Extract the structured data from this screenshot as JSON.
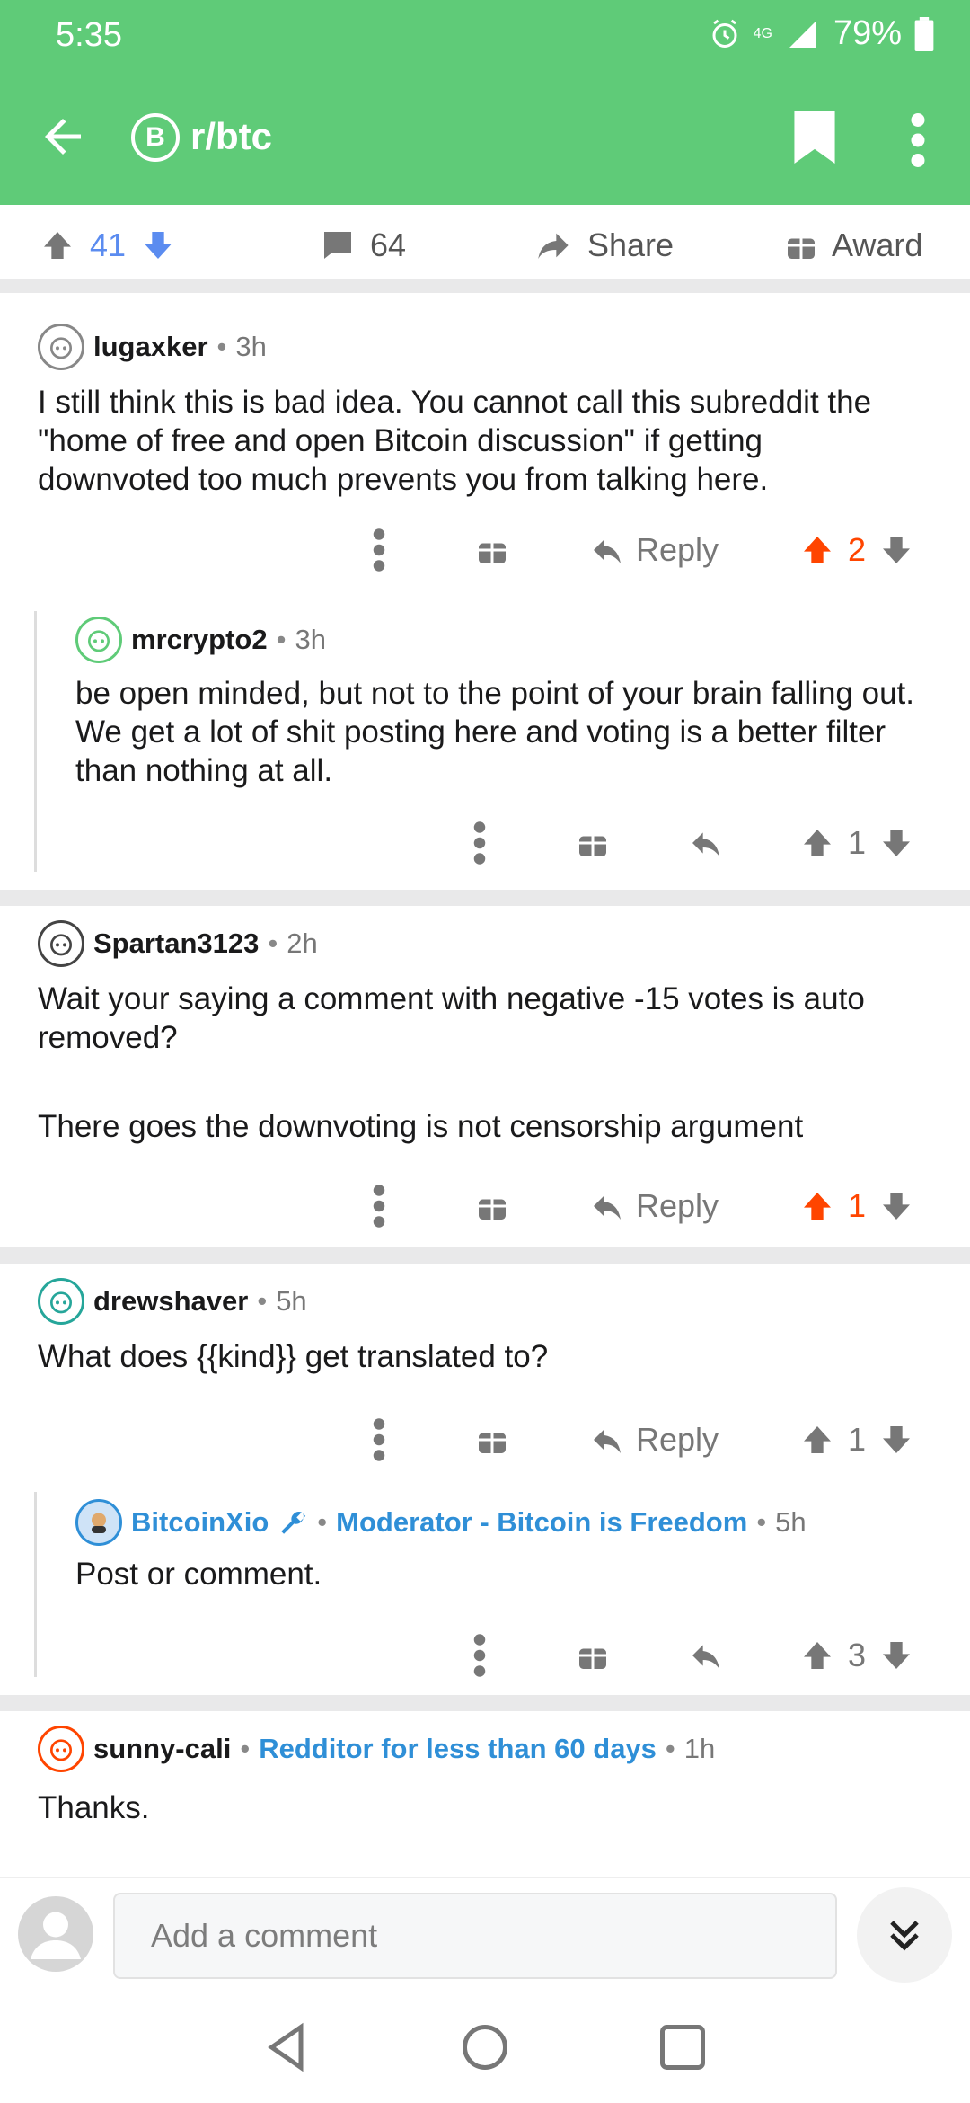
{
  "status_bar": {
    "time": "5:35",
    "network": "4G",
    "battery": "79%"
  },
  "header": {
    "subreddit": "r/btc",
    "subreddit_icon_glyph": "B",
    "accent_color": "#5fcb78"
  },
  "post_actions": {
    "score": "41",
    "comments": "64",
    "share_label": "Share",
    "award_label": "Award"
  },
  "comments": [
    {
      "author": "lugaxker",
      "age": "3h",
      "body": "I still think this is bad idea. You cannot call this subreddit the \"home of free and open Bitcoin discussion\" if getting downvoted too much prevents you from talking here.",
      "reply_label": "Reply",
      "score": "2",
      "upvoted": true
    },
    {
      "author": "mrcrypto2",
      "age": "3h",
      "body": "be open minded, but not to the point of your brain falling out.  We get a lot of shit posting here and voting is a better filter than nothing at all.",
      "score": "1"
    },
    {
      "author": "Spartan3123",
      "age": "2h",
      "body_line1": "Wait your saying a comment with negative -15 votes is auto removed?",
      "body_line2": "There goes the downvoting is not censorship argument",
      "reply_label": "Reply",
      "score": "1",
      "upvoted": true
    },
    {
      "author": "drewshaver",
      "age": "5h",
      "body": "What does {{kind}} get translated to?",
      "reply_label": "Reply",
      "score": "1"
    },
    {
      "author": "BitcoinXio",
      "flair": "Moderator - Bitcoin is Freedom",
      "age": "5h",
      "body": "Post or comment.",
      "score": "3"
    },
    {
      "author": "sunny-cali",
      "flair": "Redditor for less than 60 days",
      "age": "1h",
      "body": "Thanks."
    }
  ],
  "composer": {
    "placeholder": "Add a comment"
  },
  "colors": {
    "upvote": "#ff4500",
    "upvote_blue": "#5b8cf0",
    "flair": "#2f8fd7"
  }
}
